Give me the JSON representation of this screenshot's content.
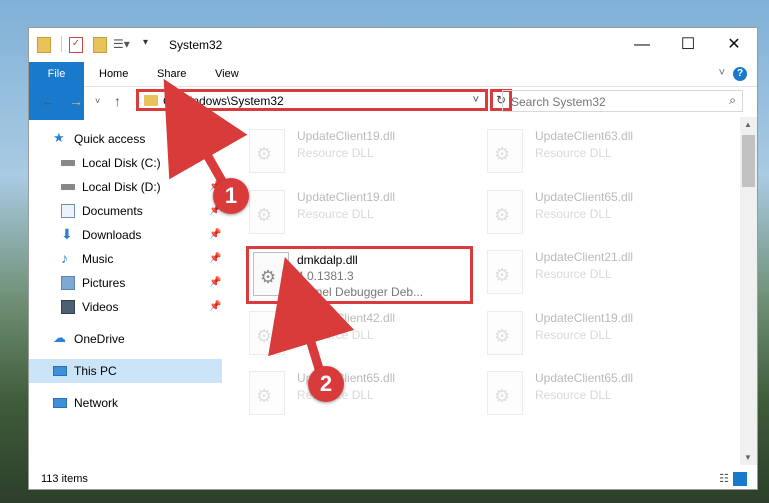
{
  "window": {
    "title": "System32",
    "controls": {
      "minimize": "—",
      "maximize": "☐",
      "close": "✕"
    }
  },
  "ribbon": {
    "tabs": [
      "File",
      "Home",
      "Share",
      "View"
    ],
    "help": "?"
  },
  "nav": {
    "address": "C:\\Windows\\System32",
    "search_placeholder": "Search System32"
  },
  "sidebar": {
    "items": [
      {
        "label": "Quick access",
        "icon": "star-icon",
        "pinned": false
      },
      {
        "label": "Local Disk (C:)",
        "icon": "drive-icon",
        "pinned": false
      },
      {
        "label": "Local Disk (D:)",
        "icon": "drive-icon",
        "pinned": true
      },
      {
        "label": "Documents",
        "icon": "documents-icon",
        "pinned": true
      },
      {
        "label": "Downloads",
        "icon": "downloads-icon",
        "pinned": true
      },
      {
        "label": "Music",
        "icon": "music-icon",
        "pinned": true
      },
      {
        "label": "Pictures",
        "icon": "pictures-icon",
        "pinned": true
      },
      {
        "label": "Videos",
        "icon": "videos-icon",
        "pinned": true
      },
      {
        "label": "OneDrive",
        "icon": "cloud-icon",
        "pinned": false
      },
      {
        "label": "This PC",
        "icon": "computer-icon",
        "pinned": false,
        "selected": true
      },
      {
        "label": "Network",
        "icon": "network-icon",
        "pinned": false
      }
    ]
  },
  "files": {
    "left": [
      {
        "name": "UpdateClient19.dll",
        "type": "Resource DLL"
      },
      {
        "name": "UpdateClient19.dll",
        "type": "Resource DLL"
      },
      {
        "name": "dmkdalp.dll",
        "version": "4.0.1381.3",
        "description": "Kernel Debugger Deb..."
      },
      {
        "name": "UpdateClient42.dll",
        "type": "Resource DLL"
      },
      {
        "name": "UpdateClient65.dll",
        "type": "Resource DLL"
      }
    ],
    "right": [
      {
        "name": "UpdateClient63.dll",
        "type": "Resource DLL"
      },
      {
        "name": "UpdateClient65.dll",
        "type": "Resource DLL"
      },
      {
        "name": "UpdateClient21.dll",
        "type": "Resource DLL"
      },
      {
        "name": "UpdateClient19.dll",
        "type": "Resource DLL"
      },
      {
        "name": "UpdateClient65.dll",
        "type": "Resource DLL"
      }
    ]
  },
  "status": {
    "item_count": "113 items"
  },
  "annotations": {
    "step1": "1",
    "step2": "2"
  },
  "colors": {
    "accent": "#1979ca",
    "highlight": "#d93a3a",
    "selected": "#cce4f7"
  }
}
